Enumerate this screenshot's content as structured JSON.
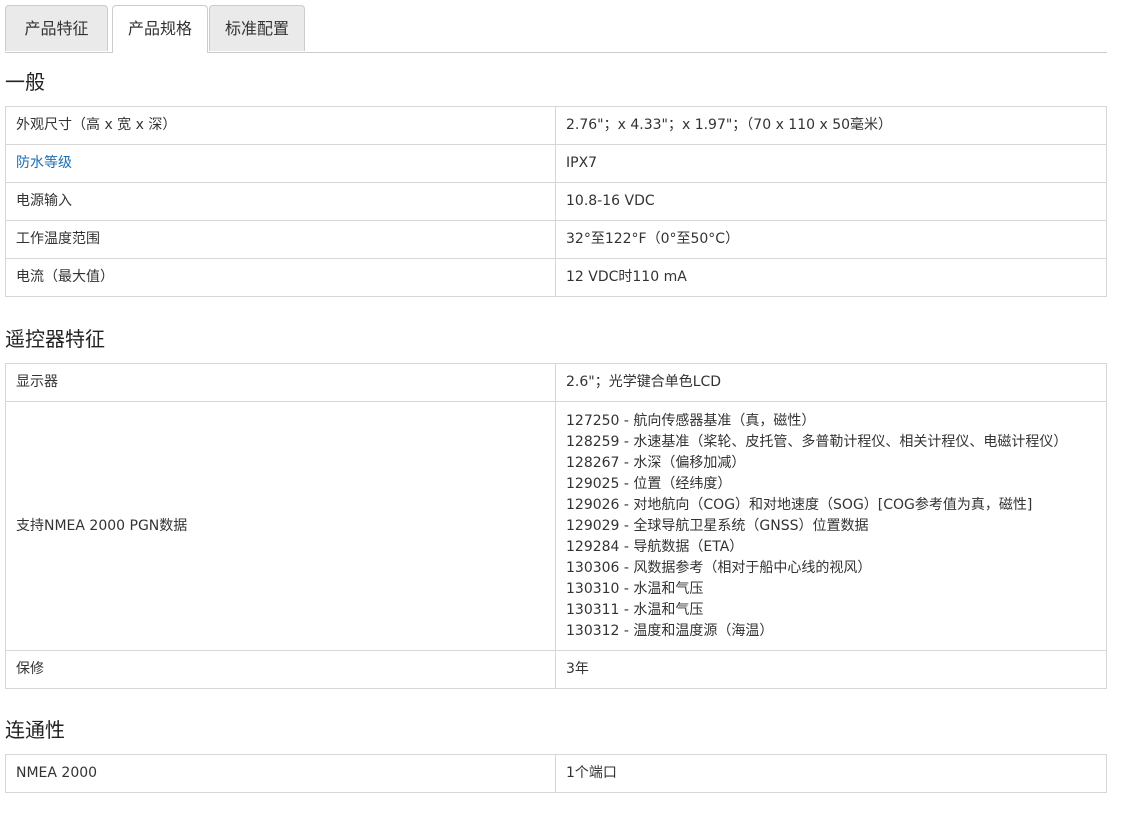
{
  "tabs": [
    {
      "label": "产品特征",
      "active": false
    },
    {
      "label": "产品规格",
      "active": true
    },
    {
      "label": "标准配置",
      "active": false
    }
  ],
  "sections": [
    {
      "title": "一般",
      "rows": [
        {
          "label": "外观尺寸（高 x 宽 x 深）",
          "value": "2.76\"；x 4.33\"；x 1.97\"；（70 x 110 x 50毫米）"
        },
        {
          "label": "防水等级",
          "value": "IPX7",
          "label_is_link": true
        },
        {
          "label": "电源输入",
          "value": "10.8-16 VDC"
        },
        {
          "label": "工作温度范围",
          "value": "32°至122°F（0°至50°C）"
        },
        {
          "label": "电流（最大值）",
          "value": "12 VDC时110 mA"
        }
      ]
    },
    {
      "title": "遥控器特征",
      "rows": [
        {
          "label": "显示器",
          "value": "2.6\"；光学键合单色LCD"
        },
        {
          "label": "支持NMEA 2000 PGN数据",
          "values": [
            "127250 - 航向传感器基准（真，磁性）",
            "128259 - 水速基准（桨轮、皮托管、多普勒计程仪、相关计程仪、电磁计程仪）",
            "128267 - 水深（偏移加减）",
            "129025 - 位置（经纬度）",
            "129026 - 对地航向（COG）和对地速度（SOG）[COG参考值为真，磁性]",
            "129029 - 全球导航卫星系统（GNSS）位置数据",
            "129284 - 导航数据（ETA）",
            "130306 - 风数据参考（相对于船中心线的视风）",
            "130310 - 水温和气压",
            "130311 - 水温和气压",
            "130312 - 温度和温度源（海温）"
          ]
        },
        {
          "label": "保修",
          "value": "3年"
        }
      ]
    },
    {
      "title": "连通性",
      "rows": [
        {
          "label": "NMEA 2000",
          "value": "1个端口"
        }
      ]
    }
  ]
}
